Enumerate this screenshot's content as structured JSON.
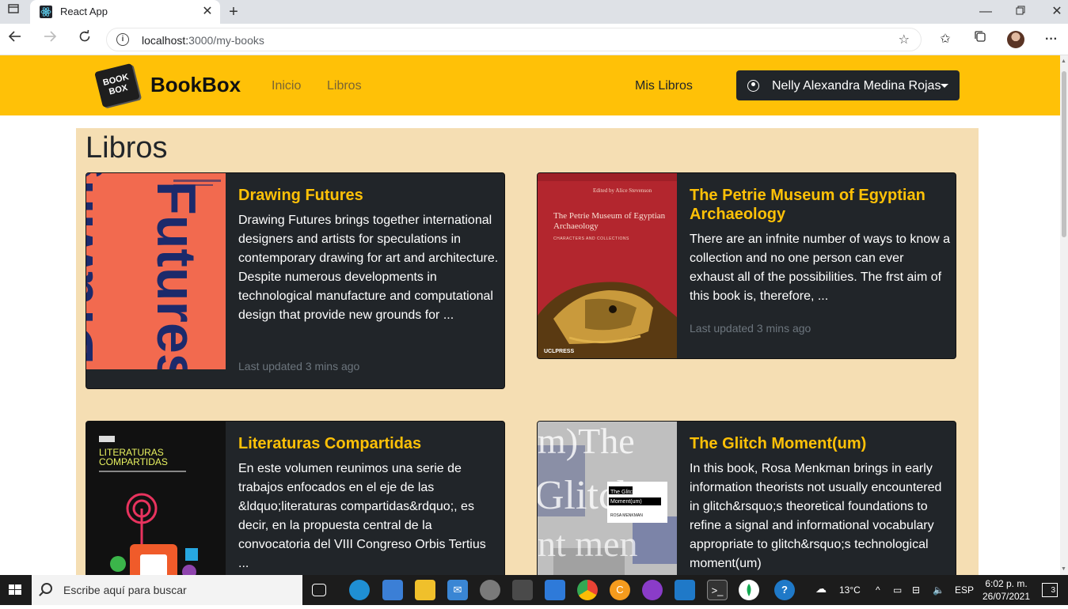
{
  "browser": {
    "tab_title": "React App",
    "url_host": "localhost:",
    "url_path": "3000/my-books"
  },
  "navbar": {
    "logo_top": "BOOK",
    "logo_bottom": "BOX",
    "brand": "BookBox",
    "links": [
      "Inicio",
      "Libros"
    ],
    "my_books": "Mis Libros",
    "user_name": "Nelly Alexandra Medina Rojas"
  },
  "main": {
    "heading": "Libros",
    "books": [
      {
        "title": "Drawing Futures",
        "description": "Drawing Futures brings together international designers and artists for speculations in contemporary drawing for art and architecture. Despite numerous developments in technological manufacture and computational design that provide new grounds for ...",
        "updated": "Last updated 3 mins ago",
        "cover_text": "Drawing Futures",
        "cover_color": "#f26a4f"
      },
      {
        "title": "The Petrie Museum of Egyptian Archaeology",
        "description": "There are an infnite number of ways to know a collection and no one person can ever exhaust all of the possibilities. The frst aim of this book is, therefore, ...",
        "updated": "Last updated 3 mins ago",
        "cover_title": "The Petrie Museum of Egyptian Archaeology",
        "cover_sub": "CHARACTERS AND COLLECTIONS",
        "cover_editor": "Edited by Alice Stevenson",
        "cover_publisher": "UCLPRESS",
        "cover_color": "#b3262e"
      },
      {
        "title": "Literaturas Compartidas",
        "description": "En este volumen reunimos una serie de trabajos enfocados en el eje de las &ldquo;literaturas compartidas&rdquo;, es decir, en la propuesta central de la convocatoria del VIII Congreso Orbis Tertius ...",
        "cover_title": "LITERATURAS COMPARTIDAS",
        "cover_color": "#111111"
      },
      {
        "title": "The Glitch Moment(um)",
        "description": "In this book, Rosa Menkman brings in early information theorists not usually encountered in glitch&rsquo;s theoretical foundations to refine a signal and informational vocabulary appropriate to glitch&rsquo;s technological moment(um)",
        "cover_title": "The Glitch Moment(um)",
        "cover_author": "ROSA MENKMAN",
        "cover_color": "#d8d8d8"
      }
    ]
  },
  "taskbar": {
    "search_placeholder": "Escribe aquí para buscar",
    "temperature": "13°C",
    "language": "ESP",
    "time": "6:02 p. m.",
    "date": "26/07/2021",
    "notifications": "3"
  }
}
